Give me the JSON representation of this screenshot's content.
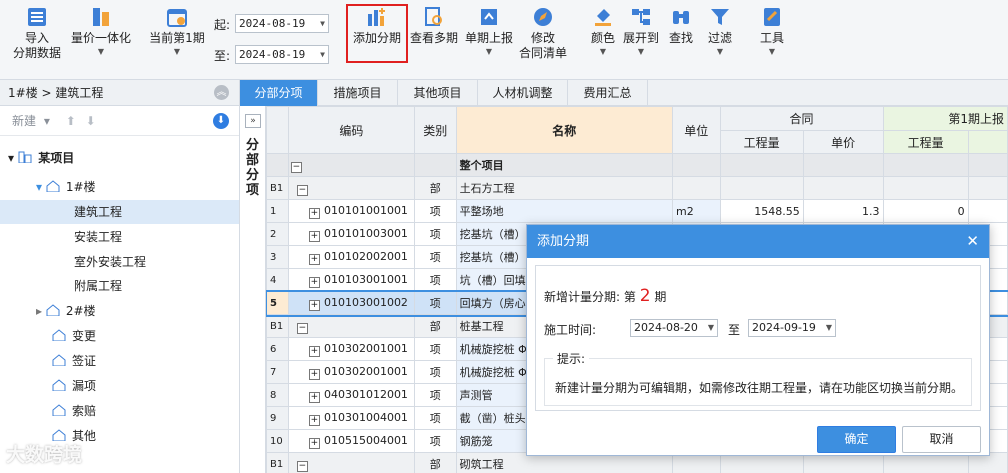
{
  "toolbar": {
    "import": "导入",
    "import2": "分期数据",
    "price_integration": "量价一体化",
    "current_period": "当前第1期",
    "start_label": "起:",
    "start_date": "2024-08-19",
    "end_label": "至:",
    "end_date": "2024-08-19",
    "add_period": "添加分期",
    "view_multi": "查看多期",
    "single_report": "单期上报",
    "modify": "修改",
    "modify2": "合同清单",
    "color": "颜色",
    "expand": "展开到",
    "find": "查找",
    "filter": "过滤",
    "tools": "工具"
  },
  "left": {
    "breadcrumb": "1#楼 > 建筑工程",
    "new_label": "新建",
    "tree": [
      "某项目",
      "1#楼",
      "建筑工程",
      "安装工程",
      "室外安装工程",
      "附属工程",
      "2#楼",
      "变更",
      "签证",
      "漏项",
      "索赔",
      "其他"
    ]
  },
  "tabs": [
    "分部分项",
    "措施项目",
    "其他项目",
    "人材机调整",
    "费用汇总"
  ],
  "side_label": "分部分项",
  "grid": {
    "headers": {
      "code": "编码",
      "type": "类别",
      "name": "名称",
      "unit": "单位",
      "contract": "合同",
      "qty": "工程量",
      "price": "单价",
      "period1": "第1期上报",
      "p1qty": "工程量"
    },
    "rows": [
      {
        "rn": "",
        "code": "",
        "type": "",
        "name": "整个项目",
        "unit": "",
        "qty": "",
        "price": "",
        "p1": ""
      },
      {
        "rn": "B1",
        "code": "",
        "type": "部",
        "name": "土石方工程",
        "unit": "",
        "qty": "",
        "price": "",
        "p1": ""
      },
      {
        "rn": "1",
        "code": "010101001001",
        "type": "项",
        "name": "平整场地",
        "unit": "m2",
        "qty": "1548.55",
        "price": "1.3",
        "p1": "0"
      },
      {
        "rn": "2",
        "code": "010101003001",
        "type": "项",
        "name": "挖基坑（槽）",
        "unit": "",
        "qty": "",
        "price": "",
        "p1": ""
      },
      {
        "rn": "3",
        "code": "010102002001",
        "type": "项",
        "name": "挖基坑（槽）",
        "unit": "",
        "qty": "",
        "price": "",
        "p1": ""
      },
      {
        "rn": "4",
        "code": "010103001001",
        "type": "项",
        "name": "坑（槽）回填",
        "unit": "",
        "qty": "",
        "price": "",
        "p1": ""
      },
      {
        "rn": "5",
        "code": "010103001002",
        "type": "项",
        "name": "回填方（房心",
        "unit": "",
        "qty": "",
        "price": "",
        "p1": ""
      },
      {
        "rn": "B1",
        "code": "",
        "type": "部",
        "name": "桩基工程",
        "unit": "",
        "qty": "",
        "price": "",
        "p1": ""
      },
      {
        "rn": "6",
        "code": "010302001001",
        "type": "项",
        "name": "机械旋挖桩 Φ",
        "unit": "",
        "qty": "",
        "price": "",
        "p1": ""
      },
      {
        "rn": "7",
        "code": "010302001001",
        "type": "项",
        "name": "机械旋挖桩 Φ",
        "unit": "",
        "qty": "",
        "price": "",
        "p1": ""
      },
      {
        "rn": "8",
        "code": "040301012001",
        "type": "项",
        "name": "声测管",
        "unit": "",
        "qty": "",
        "price": "",
        "p1": ""
      },
      {
        "rn": "9",
        "code": "010301004001",
        "type": "项",
        "name": "截（凿）桩头",
        "unit": "",
        "qty": "",
        "price": "",
        "p1": ""
      },
      {
        "rn": "10",
        "code": "010515004001",
        "type": "项",
        "name": "钢筋笼",
        "unit": "",
        "qty": "",
        "price": "",
        "p1": ""
      },
      {
        "rn": "B1",
        "code": "",
        "type": "部",
        "name": "砌筑工程",
        "unit": "",
        "qty": "",
        "price": "",
        "p1": ""
      }
    ]
  },
  "dialog": {
    "title": "添加分期",
    "new_period_prefix": "新增计量分期: 第",
    "period_num": "2",
    "period_suffix": "期",
    "time_label": "施工时间:",
    "from_date": "2024-08-20",
    "to_label": "至",
    "to_date": "2024-09-19",
    "tip_label": "提示:",
    "tip_text": "新建计量分期为可编辑期，如需修改往期工程量，请在功能区切换当前分期。",
    "ok": "确定",
    "cancel": "取消"
  },
  "watermark": "大数跨境",
  "colors": {
    "accent": "#3d8fe0",
    "highlight": "#e02020"
  }
}
